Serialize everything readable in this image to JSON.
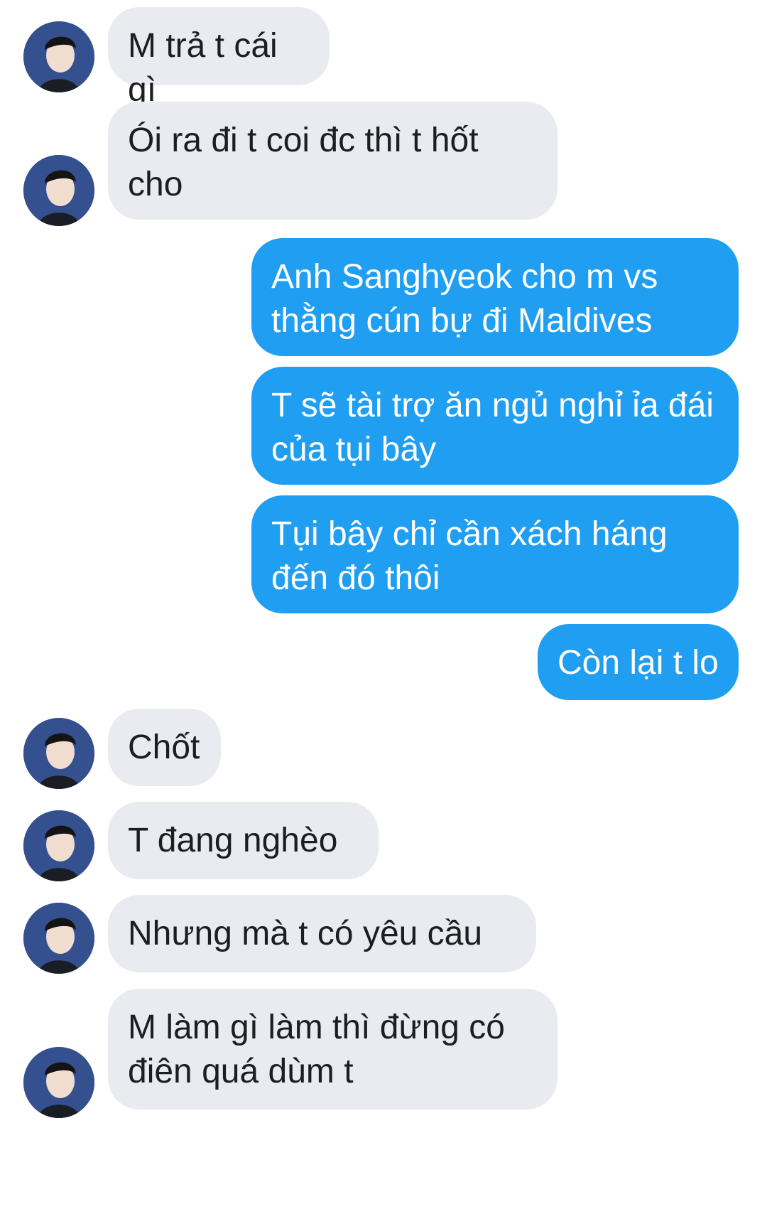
{
  "conversation": {
    "messages": [
      {
        "sender": "other",
        "text": "M trả t cái gì"
      },
      {
        "sender": "other",
        "text": "Ói ra đi t coi đc thì t hốt cho"
      },
      {
        "sender": "me",
        "text": "Anh Sanghyeok cho m vs thằng cún bự đi Maldives"
      },
      {
        "sender": "me",
        "text": "T sẽ tài trợ ăn ngủ nghỉ ỉa đái của tụi bây"
      },
      {
        "sender": "me",
        "text": "Tụi bây chỉ cần xách háng đến đó thôi"
      },
      {
        "sender": "me",
        "text": "Còn lại t lo"
      },
      {
        "sender": "other",
        "text": "Chốt"
      },
      {
        "sender": "other",
        "text": "T đang nghèo"
      },
      {
        "sender": "other",
        "text": "Nhưng mà t có yêu cầu"
      },
      {
        "sender": "other",
        "text": "M làm gì làm thì đừng có điên quá dùm t"
      }
    ]
  },
  "colors": {
    "incoming_bubble": "#e9ebf0",
    "outgoing_bubble": "#1f9ef2",
    "avatar_bg": "#2f4a8c"
  },
  "icons": {
    "avatar": "contact-avatar-photo"
  }
}
